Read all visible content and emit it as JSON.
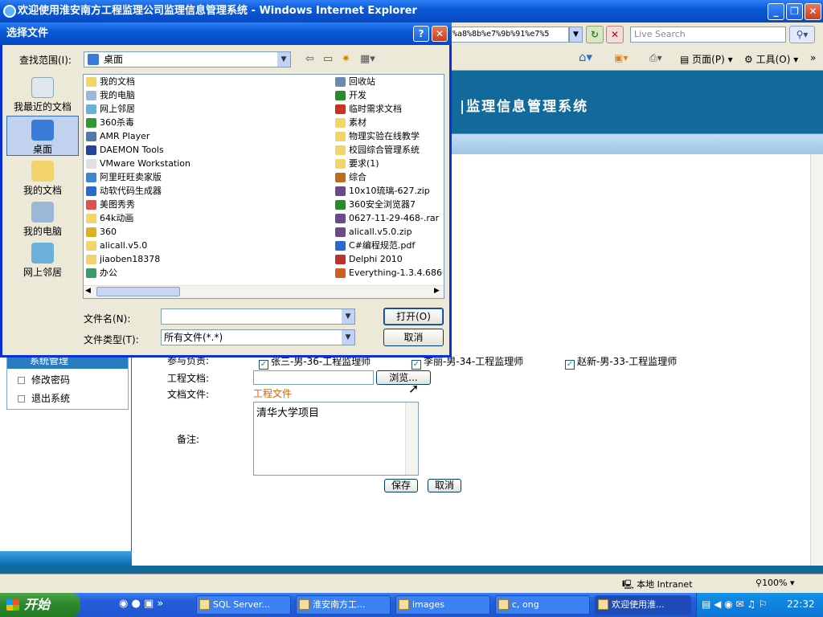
{
  "window": {
    "title": "欢迎使用淮安南方工程监理公司监理信息管理系统 - Windows Internet Explorer",
    "minimize": "_",
    "maximize": "❐",
    "close": "✕"
  },
  "browser": {
    "address": "%a8%8b%e7%9b%91%e7%5",
    "search_placeholder": "Live Search",
    "page_menu": "页面(P)",
    "tools_menu": "工具(O)"
  },
  "page": {
    "banner_title": "|监理信息管理系统",
    "sidebar": {
      "section": "系统管理",
      "items": [
        "修改密码",
        "退出系统"
      ]
    },
    "form": {
      "participants_label": "参与负责:",
      "participants": [
        "张三-男-36-工程监理师",
        "李丽-男-34-工程监理师",
        "赵新-男-33-工程监理师"
      ],
      "doc_label": "工程文档:",
      "browse_label": "浏览...",
      "file_label": "文档文件:",
      "file_link": "工程文件",
      "remark_label": "备注:",
      "remark_value": "清华大学项目",
      "save": "保存",
      "cancel": "取消"
    }
  },
  "status": {
    "zone": "本地 Intranet",
    "zoom": "100%"
  },
  "taskbar": {
    "start": "开始",
    "tasks": [
      "SQL Server...",
      "淮安南方工...",
      "images",
      "c, ong",
      "欢迎使用淮..."
    ],
    "clock": "22:32"
  },
  "dialog": {
    "title": "选择文件",
    "help": "?",
    "close": "✕",
    "look_in_label": "查找范围(I):",
    "look_in_value": "桌面",
    "places": [
      "我最近的文档",
      "桌面",
      "我的文档",
      "我的电脑",
      "网上邻居"
    ],
    "files_left": [
      "我的文档",
      "我的电脑",
      "网上邻居",
      "360杀毒",
      "AMR Player",
      "DAEMON Tools",
      "VMware Workstation",
      "阿里旺旺卖家版",
      "动软代码生成器",
      "美图秀秀",
      "64k动画",
      "360",
      "alicall.v5.0",
      "jiaoben18378",
      "办公"
    ],
    "files_right": [
      "回收站",
      "开发",
      "临时需求文档",
      "素材",
      "物理实验在线教学",
      "校园综合管理系统",
      "要求(1)",
      "综合",
      "10x10琉璃-627.zip",
      "360安全浏览器7",
      "0627-11-29-468-.rar",
      "alicall.v5.0.zip",
      "C#编程规范.pdf",
      "Delphi 2010",
      "Everything-1.3.4.686"
    ],
    "filename_label": "文件名(N):",
    "filename_value": "",
    "filetype_label": "文件类型(T):",
    "filetype_value": "所有文件(*.*)",
    "open": "打开(O)",
    "cancel": "取消"
  },
  "colors": {
    "titlebar": "#0a5ad8",
    "banner": "#116a9b",
    "dialog_bg": "#ece9d8",
    "link": "#d56500"
  }
}
